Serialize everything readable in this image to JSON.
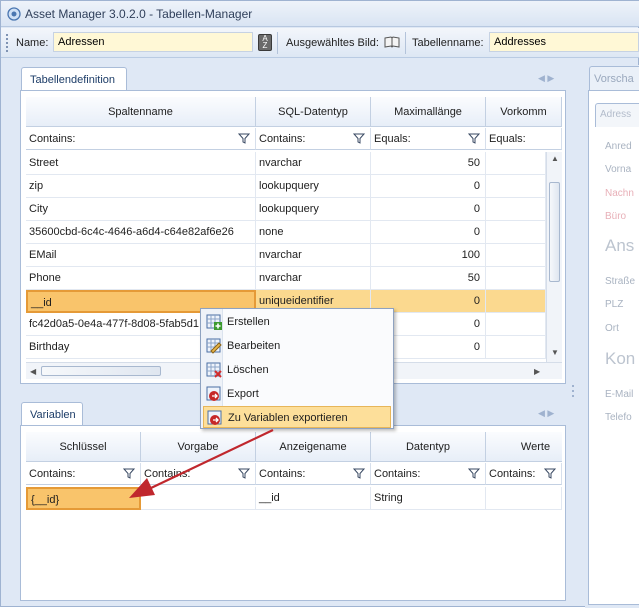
{
  "app": {
    "title": "Asset Manager 3.0.2.0 - Tabellen-Manager"
  },
  "toolbar": {
    "name_label": "Name:",
    "name_value": "Adressen",
    "bild_label": "Ausgewähltes Bild:",
    "tabellenname_label": "Tabellenname:",
    "tabellenname_value": "Addresses"
  },
  "tabellendefinition": {
    "tab_label": "Tabellendefinition",
    "columns": [
      "Spaltenname",
      "SQL-Datentyp",
      "Maximallänge",
      "Vorkomm"
    ],
    "filters": [
      "Contains:",
      "Contains:",
      "Equals:",
      "Equals:"
    ],
    "rows": [
      {
        "name": "Street",
        "type": "nvarchar",
        "max": "50"
      },
      {
        "name": "zip",
        "type": "lookupquery",
        "max": "0"
      },
      {
        "name": "City",
        "type": "lookupquery",
        "max": "0"
      },
      {
        "name": "35600cbd-6c4c-4646-a6d4-c64e82af6e26",
        "type": "none",
        "max": "0"
      },
      {
        "name": "EMail",
        "type": "nvarchar",
        "max": "100"
      },
      {
        "name": "Phone",
        "type": "nvarchar",
        "max": "50"
      },
      {
        "name": "__id",
        "type": "uniqueidentifier",
        "max": "0"
      },
      {
        "name": "fc42d0a5-0e4a-477f-8d08-5fab5d1",
        "type": "",
        "max": "0"
      },
      {
        "name": "Birthday",
        "type": "",
        "max": "0"
      }
    ]
  },
  "context_menu": {
    "items": [
      "Erstellen",
      "Bearbeiten",
      "Löschen",
      "Export",
      "Zu Variablen exportieren"
    ],
    "highlighted": "Zu Variablen exportieren"
  },
  "variablen": {
    "tab_label": "Variablen",
    "columns": [
      "Schlüssel",
      "Vorgabe",
      "Anzeigename",
      "Datentyp",
      "Werte"
    ],
    "filters": [
      "Contains:",
      "Contains:",
      "Contains:",
      "Contains:",
      "Contains:"
    ],
    "rows": [
      {
        "key": "{__id}",
        "default": "",
        "display": "__id",
        "datatype": "String",
        "values": ""
      }
    ]
  },
  "right_panel": {
    "tab": "Vorscha",
    "subtab": "Adress",
    "fields": [
      "Anred",
      "Vorna",
      "Nachn",
      "Büro",
      "Ans",
      "Straße",
      "PLZ",
      "Ort",
      "Kon",
      "E-Mail",
      "Telefo"
    ]
  }
}
